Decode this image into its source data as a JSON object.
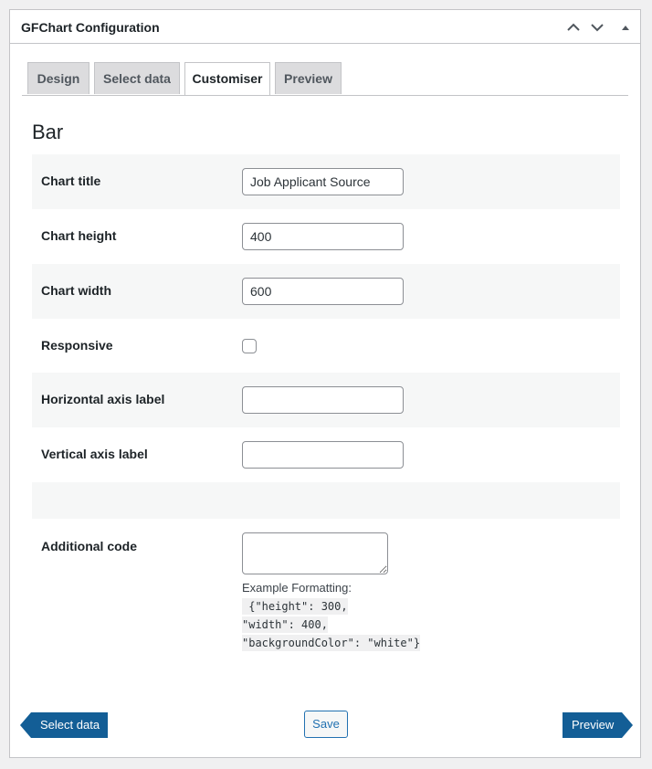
{
  "panel": {
    "title": "GFChart Configuration"
  },
  "header_controls": [
    "chevron-up-icon",
    "chevron-down-icon",
    "triangle-up-icon"
  ],
  "tabs": [
    {
      "label": "Design",
      "active": false
    },
    {
      "label": "Select data",
      "active": false
    },
    {
      "label": "Customiser",
      "active": true
    },
    {
      "label": "Preview",
      "active": false
    }
  ],
  "section": {
    "title": "Bar"
  },
  "fields": {
    "chart_title": {
      "label": "Chart title",
      "value": "Job Applicant Source"
    },
    "chart_height": {
      "label": "Chart height",
      "value": "400"
    },
    "chart_width": {
      "label": "Chart width",
      "value": "600"
    },
    "responsive": {
      "label": "Responsive",
      "checked": false
    },
    "horizontal_axis_label": {
      "label": "Horizontal axis label",
      "value": ""
    },
    "vertical_axis_label": {
      "label": "Vertical axis label",
      "value": ""
    },
    "additional_code": {
      "label": "Additional code",
      "value": "",
      "example_label": "Example Formatting:",
      "example_lines": [
        " {\"height\": 300,",
        "\"width\": 400,",
        "\"backgroundColor\": \"white\"}"
      ]
    }
  },
  "footer": {
    "prev_label": "Select data",
    "save_label": "Save",
    "next_label": "Preview"
  },
  "colors": {
    "primary": "#135e96",
    "link": "#2271b1",
    "row_alt": "#f6f7f7"
  }
}
